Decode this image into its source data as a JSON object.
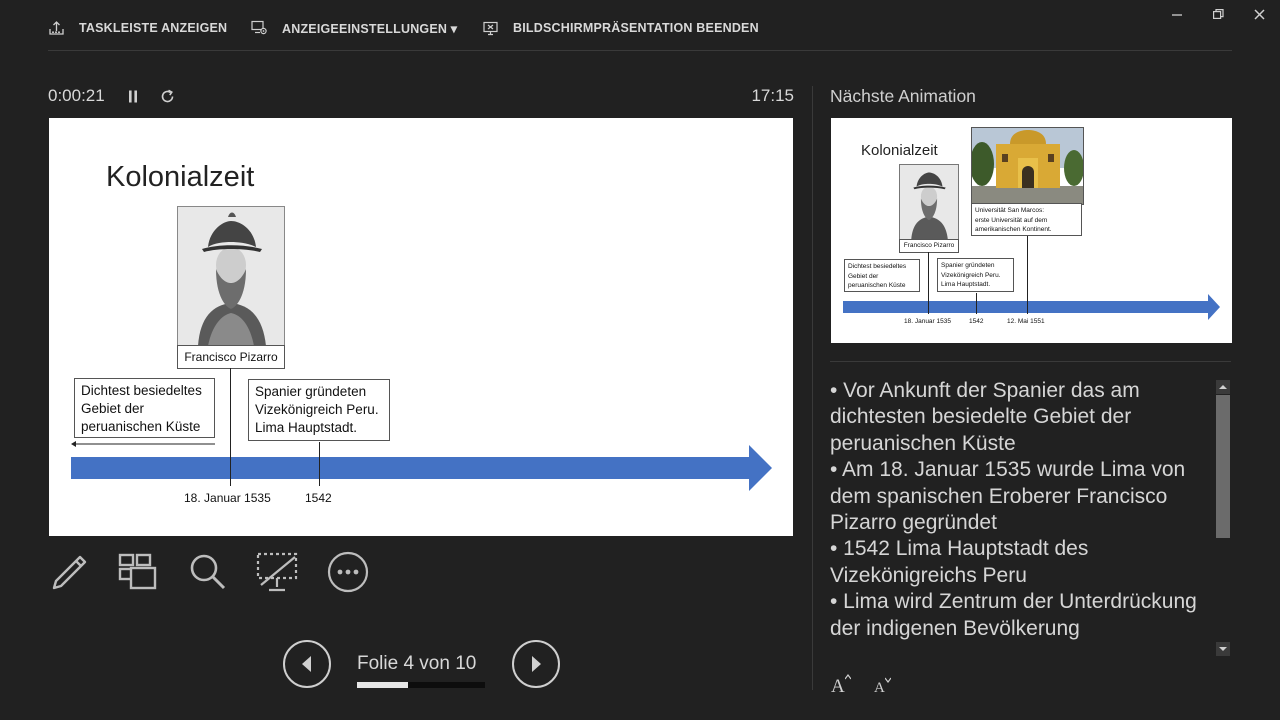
{
  "toolbar": {
    "show_taskbar": "TASKLEISTE ANZEIGEN",
    "display_settings": "ANZEIGEEINSTELLUNGEN ▾",
    "end_slideshow": "BILDSCHIRMPRÄSENTATION BEENDEN"
  },
  "window": {
    "minimize_icon": "minimize-icon",
    "restore_icon": "restore-icon",
    "close_icon": "close-icon"
  },
  "presenter": {
    "timer": "0:00:21",
    "clock": "17:15",
    "slide_counter": "Folie 4 von 10",
    "progress_fraction": 0.4
  },
  "current_slide": {
    "title": "Kolonialzeit",
    "portrait_caption": "Francisco Pizarro",
    "box_left": [
      "Dichtest besiedeltes",
      "Gebiet der",
      "peruanischen Küste"
    ],
    "box_right": [
      "Spanier gründeten",
      "Vizekönigreich Peru.",
      "Lima Hauptstadt."
    ],
    "date_1": "18. Januar 1535",
    "date_2": "1542",
    "arrow_color": "#4472c4"
  },
  "next": {
    "label": "Nächste Animation",
    "title": "Kolonialzeit",
    "portrait_caption": "Francisco Pizarro",
    "uni_caption": [
      "Universität San Marcos:",
      "erste Universität auf dem",
      "amerikanischen Kontinent."
    ],
    "box_left": [
      "Dichtest besiedeltes",
      "Gebiet der",
      "peruanischen Küste"
    ],
    "box_right": [
      "Spanier gründeten",
      "Vizekönigreich Peru.",
      "Lima Hauptstadt."
    ],
    "date_1": "18. Januar 1535",
    "date_2": "1542",
    "date_3": "12. Mai 1551"
  },
  "notes": [
    "• Vor Ankunft der Spanier das am dichtesten besiedelte Gebiet der peruanischen Küste",
    "• Am 18. Januar 1535 wurde Lima von dem spanischen Eroberer Francisco Pizarro gegründet",
    "• 1542 Lima Hauptstadt des Vizekönigreichs Peru",
    "• Lima wird Zentrum der Unterdrückung der indigenen Bevölkerung"
  ],
  "font_controls": {
    "increase": "A",
    "decrease": "A"
  }
}
